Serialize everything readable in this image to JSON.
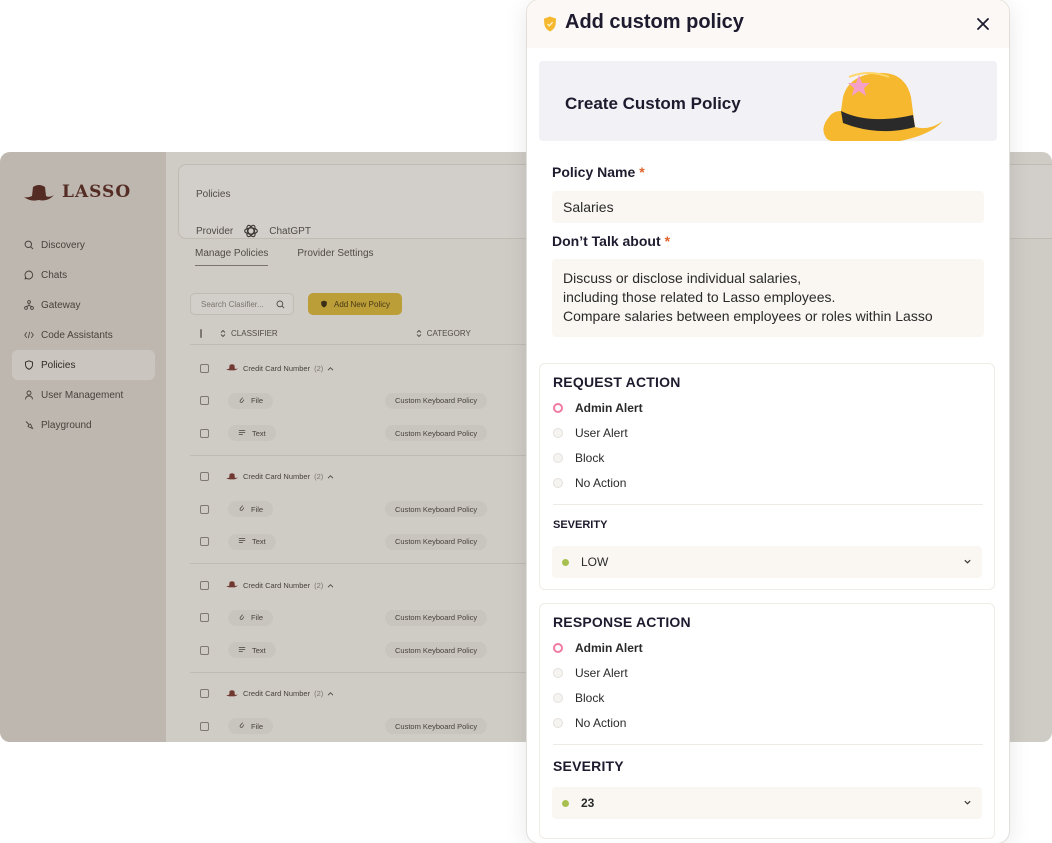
{
  "app": {
    "logo_text": "LASSO",
    "nav": [
      {
        "label": "Discovery",
        "icon": "search-icon"
      },
      {
        "label": "Chats",
        "icon": "chat-icon"
      },
      {
        "label": "Gateway",
        "icon": "gateway-icon"
      },
      {
        "label": "Code Assistants",
        "icon": "code-icon"
      },
      {
        "label": "Policies",
        "icon": "shield-icon",
        "active": true
      },
      {
        "label": "User Management",
        "icon": "user-icon"
      },
      {
        "label": "Playground",
        "icon": "playground-icon"
      }
    ],
    "breadcrumb": "Policies",
    "provider_label": "Provider",
    "provider_name": "ChatGPT",
    "tabs": [
      "Manage Policies",
      "Provider Settings"
    ],
    "search_placeholder": "Search Clasifier...",
    "add_button": "Add New Policy",
    "columns": [
      "CLASSIFIER",
      "CATEGORY"
    ],
    "groups": [
      {
        "name": "Credit Card Number",
        "count": "(2)",
        "rows": [
          {
            "source": "File",
            "category": "Custom Keyboard Policy"
          },
          {
            "source": "Text",
            "category": "Custom Keyboard Policy"
          }
        ]
      },
      {
        "name": "Credit Card Number",
        "count": "(2)",
        "rows": [
          {
            "source": "File",
            "category": "Custom Keyboard Policy"
          },
          {
            "source": "Text",
            "category": "Custom Keyboard Policy"
          }
        ]
      },
      {
        "name": "Credit Card Number",
        "count": "(2)",
        "rows": [
          {
            "source": "File",
            "category": "Custom Keyboard Policy"
          },
          {
            "source": "Text",
            "category": "Custom Keyboard Policy"
          }
        ]
      },
      {
        "name": "Credit Card Number",
        "count": "(2)",
        "rows": [
          {
            "source": "File",
            "category": "Custom Keyboard Policy"
          }
        ]
      }
    ]
  },
  "panel": {
    "title": "Add custom policy",
    "banner": "Create Custom Policy",
    "policy_name_label": "Policy Name",
    "policy_name_value": "Salaries",
    "dont_talk_label": "Don’t Talk about",
    "dont_talk_lines": [
      "Discuss or disclose individual salaries,",
      "including those related to Lasso employees.",
      "Compare salaries between employees or roles within Lasso"
    ],
    "required_mark": "*",
    "request": {
      "title": "REQUEST ACTION",
      "options": [
        "Admin Alert",
        "User Alert",
        "Block",
        "No Action"
      ],
      "selected": "Admin Alert",
      "severity_label": "SEVERITY",
      "severity_value": "LOW"
    },
    "response": {
      "title": "RESPONSE ACTION",
      "options": [
        "Admin Alert",
        "User Alert",
        "Block",
        "No Action"
      ],
      "selected": "Admin Alert",
      "severity_label": "SEVERITY",
      "severity_value": "23"
    },
    "colors": {
      "accent": "#f07aa4",
      "required": "#e0632a",
      "severity_dot": "#a7bf4f",
      "brand_yellow": "#f5b82e"
    }
  }
}
